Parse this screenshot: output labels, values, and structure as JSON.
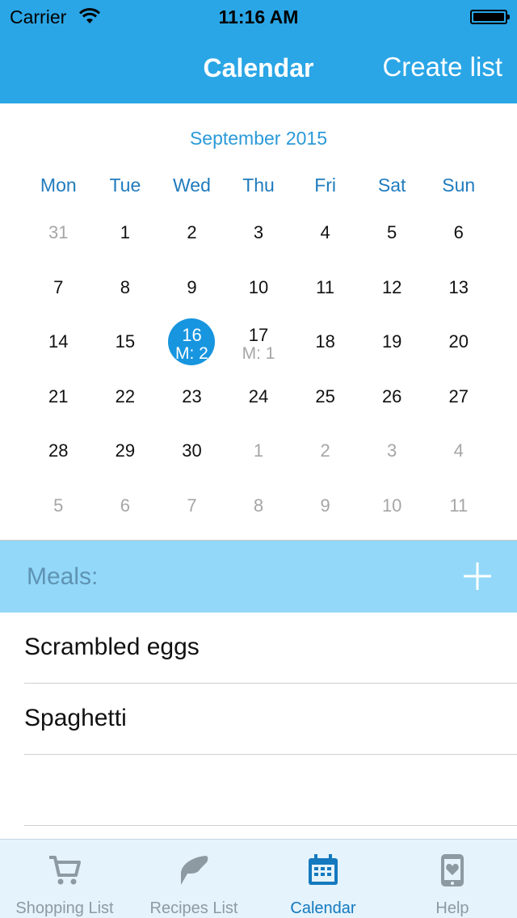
{
  "status": {
    "carrier": "Carrier",
    "time": "11:16 AM"
  },
  "nav": {
    "title": "Calendar",
    "right_button": "Create list"
  },
  "calendar": {
    "month_title": "September 2015",
    "weekdays": [
      "Mon",
      "Tue",
      "Wed",
      "Thu",
      "Fri",
      "Sat",
      "Sun"
    ],
    "weeks": [
      [
        {
          "d": "31",
          "muted": true
        },
        {
          "d": "1"
        },
        {
          "d": "2"
        },
        {
          "d": "3"
        },
        {
          "d": "4"
        },
        {
          "d": "5"
        },
        {
          "d": "6"
        }
      ],
      [
        {
          "d": "7"
        },
        {
          "d": "8"
        },
        {
          "d": "9"
        },
        {
          "d": "10"
        },
        {
          "d": "11"
        },
        {
          "d": "12"
        },
        {
          "d": "13"
        }
      ],
      [
        {
          "d": "14"
        },
        {
          "d": "15"
        },
        {
          "d": "16",
          "meal": "M: 2",
          "selected": true
        },
        {
          "d": "17",
          "meal": "M: 1"
        },
        {
          "d": "18"
        },
        {
          "d": "19"
        },
        {
          "d": "20"
        }
      ],
      [
        {
          "d": "21"
        },
        {
          "d": "22"
        },
        {
          "d": "23"
        },
        {
          "d": "24"
        },
        {
          "d": "25"
        },
        {
          "d": "26"
        },
        {
          "d": "27"
        }
      ],
      [
        {
          "d": "28"
        },
        {
          "d": "29"
        },
        {
          "d": "30"
        },
        {
          "d": "1",
          "muted": true
        },
        {
          "d": "2",
          "muted": true
        },
        {
          "d": "3",
          "muted": true
        },
        {
          "d": "4",
          "muted": true
        }
      ],
      [
        {
          "d": "5",
          "muted": true
        },
        {
          "d": "6",
          "muted": true
        },
        {
          "d": "7",
          "muted": true
        },
        {
          "d": "8",
          "muted": true
        },
        {
          "d": "9",
          "muted": true
        },
        {
          "d": "10",
          "muted": true
        },
        {
          "d": "11",
          "muted": true
        }
      ]
    ]
  },
  "meals": {
    "label": "Meals:",
    "items": [
      "Scrambled eggs",
      "Spaghetti"
    ]
  },
  "tabs": [
    {
      "label": "Shopping List",
      "icon": "cart-icon",
      "active": false
    },
    {
      "label": "Recipes List",
      "icon": "recipe-icon",
      "active": false
    },
    {
      "label": "Calendar",
      "icon": "calendar-icon",
      "active": true
    },
    {
      "label": "Help",
      "icon": "phone-heart-icon",
      "active": false
    }
  ],
  "colors": {
    "nav_bg": "#2aa6e6",
    "accent": "#1795df",
    "meals_header": "#93d8f8",
    "tab_active": "#1479be"
  }
}
